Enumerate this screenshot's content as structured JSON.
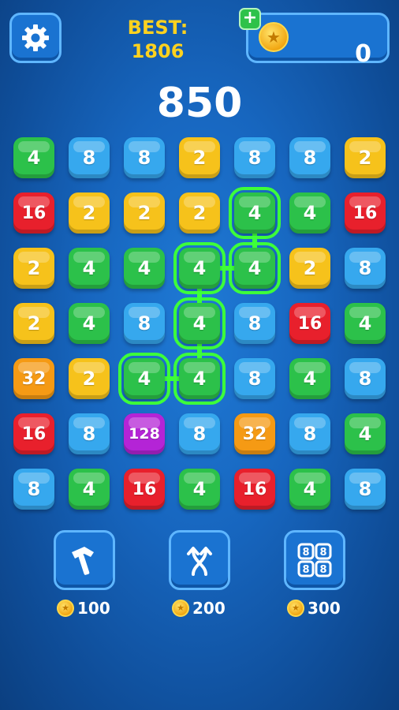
{
  "header": {
    "settings_icon": "gear-icon",
    "best_label": "BEST:",
    "best_value": "1806",
    "coins": "0",
    "add_coins_label": "+",
    "coin_icon": "coin-icon"
  },
  "score": "850",
  "colors": {
    "2": "#f6c21b",
    "4": "#2cc14a",
    "8": "#36a8ee",
    "16": "#e8202c",
    "32": "#f59a14",
    "128": "#b424d6",
    "selection": "#3dff3a"
  },
  "board": [
    [
      "4",
      "8",
      "8",
      "2",
      "8",
      "8",
      "2"
    ],
    [
      "16",
      "2",
      "2",
      "2",
      "4",
      "4",
      "16"
    ],
    [
      "2",
      "4",
      "4",
      "4",
      "4",
      "2",
      "8"
    ],
    [
      "2",
      "4",
      "8",
      "4",
      "8",
      "16",
      "4"
    ],
    [
      "32",
      "2",
      "4",
      "4",
      "8",
      "4",
      "8"
    ],
    [
      "16",
      "8",
      "128",
      "8",
      "32",
      "8",
      "4"
    ],
    [
      "8",
      "4",
      "16",
      "4",
      "16",
      "4",
      "8"
    ]
  ],
  "selected_path": [
    [
      1,
      4
    ],
    [
      2,
      4
    ],
    [
      2,
      3
    ],
    [
      3,
      3
    ],
    [
      4,
      3
    ],
    [
      4,
      2
    ]
  ],
  "tools": [
    {
      "name": "hammer",
      "icon": "hammer-icon",
      "price": "100"
    },
    {
      "name": "swap",
      "icon": "swap-arrows-icon",
      "price": "200"
    },
    {
      "name": "shuffle",
      "icon": "grid-88-icon",
      "price": "300"
    }
  ]
}
